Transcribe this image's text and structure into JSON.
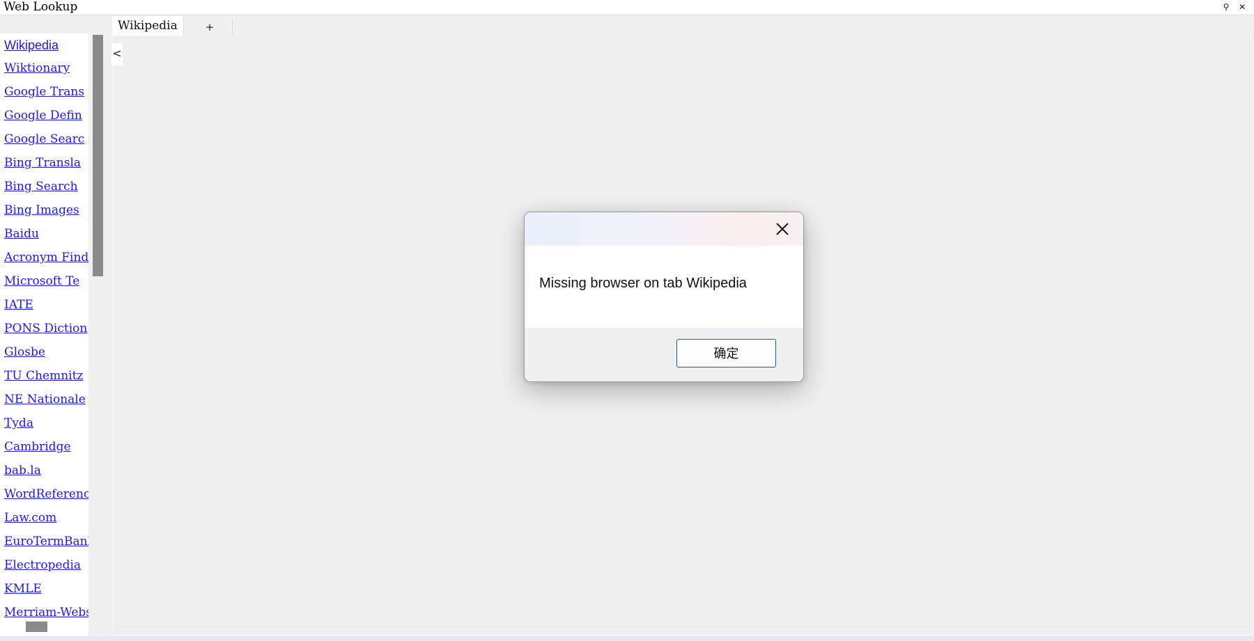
{
  "window": {
    "title": "Web Lookup",
    "pin_glyph": "⚲",
    "close_glyph": "✕"
  },
  "sidebar": {
    "items": [
      {
        "label": "Wikipedia"
      },
      {
        "label": "Wiktionary"
      },
      {
        "label": "Google Trans"
      },
      {
        "label": "Google Defin"
      },
      {
        "label": "Google Searc"
      },
      {
        "label": "Bing Transla"
      },
      {
        "label": "Bing Search"
      },
      {
        "label": "Bing Images"
      },
      {
        "label": "Baidu"
      },
      {
        "label": "Acronym Find"
      },
      {
        "label": "Microsoft Te"
      },
      {
        "label": "IATE"
      },
      {
        "label": "PONS Diction"
      },
      {
        "label": "Glosbe"
      },
      {
        "label": "TU Chemnitz "
      },
      {
        "label": "NE Nationale"
      },
      {
        "label": "Tyda"
      },
      {
        "label": "Cambridge"
      },
      {
        "label": "bab.la"
      },
      {
        "label": "WordReferenc"
      },
      {
        "label": "Law.com"
      },
      {
        "label": "EuroTermBank"
      },
      {
        "label": "Electropedia"
      },
      {
        "label": "KMLE"
      },
      {
        "label": "Merriam-Webs"
      }
    ]
  },
  "tabs": {
    "items": [
      {
        "label": "Wikipedia"
      }
    ],
    "add_label": "+"
  },
  "content": {
    "collapse_glyph": "<"
  },
  "dialog": {
    "message": "Missing browser on tab Wikipedia",
    "ok_label": "确定"
  },
  "icons": {
    "close": "close-icon",
    "pin": "pin-icon"
  }
}
